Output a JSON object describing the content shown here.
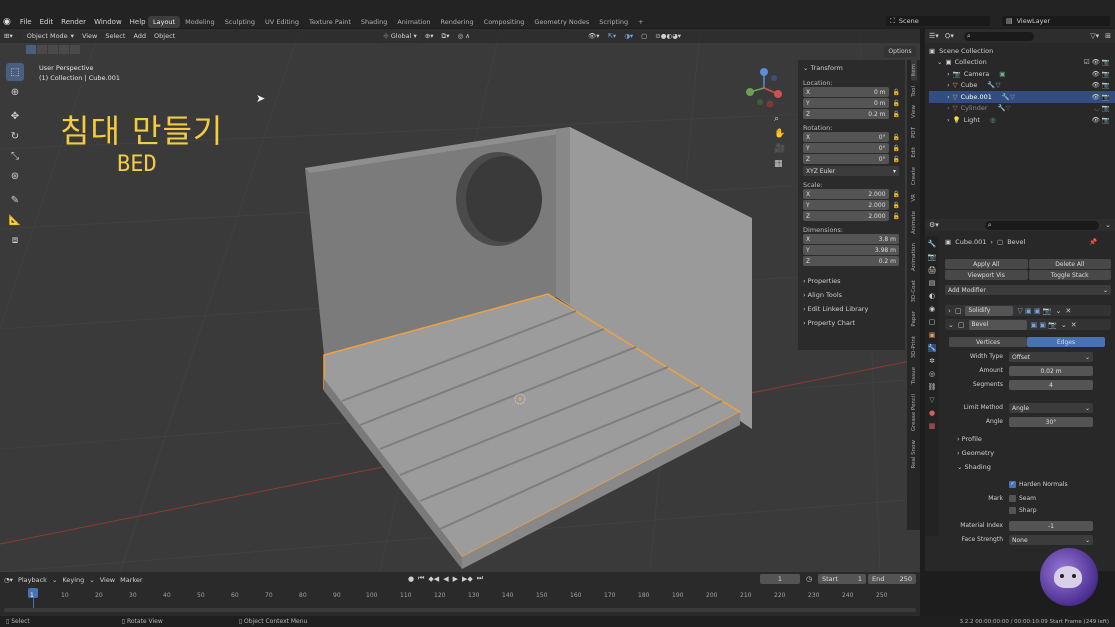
{
  "menu": {
    "items": [
      "File",
      "Edit",
      "Render",
      "Window",
      "Help"
    ],
    "workspaces": [
      "Layout",
      "Modeling",
      "Sculpting",
      "UV Editing",
      "Texture Paint",
      "Shading",
      "Animation",
      "Rendering",
      "Compositing",
      "Geometry Nodes",
      "Scripting"
    ],
    "active_workspace": "Layout",
    "add_tab": "+",
    "scene_label": "Scene",
    "viewlayer_label": "ViewLayer"
  },
  "viewport_header": {
    "mode": "Object Mode",
    "menus": [
      "View",
      "Select",
      "Add",
      "Object"
    ],
    "orientation": "Global",
    "options": "Options"
  },
  "viewport": {
    "perspective": "User Perspective",
    "collection_info": "(1) Collection | Cube.001",
    "title_korean": "침대 만들기",
    "title_english": "BED",
    "gizmo_axes": [
      "X",
      "Y",
      "Z"
    ]
  },
  "npanel": {
    "transform": "Transform",
    "location_label": "Location:",
    "location": [
      {
        "axis": "X",
        "value": "0 m"
      },
      {
        "axis": "Y",
        "value": "0 m"
      },
      {
        "axis": "Z",
        "value": "0.2 m"
      }
    ],
    "rotation_label": "Rotation:",
    "rotation": [
      {
        "axis": "X",
        "value": "0°"
      },
      {
        "axis": "Y",
        "value": "0°"
      },
      {
        "axis": "Z",
        "value": "0°"
      }
    ],
    "rotation_mode": "XYZ Euler",
    "scale_label": "Scale:",
    "scale": [
      {
        "axis": "X",
        "value": "2.000"
      },
      {
        "axis": "Y",
        "value": "2.000"
      },
      {
        "axis": "Z",
        "value": "2.000"
      }
    ],
    "dimensions_label": "Dimensions:",
    "dimensions": [
      {
        "axis": "X",
        "value": "3.8 m"
      },
      {
        "axis": "Y",
        "value": "3.98 m"
      },
      {
        "axis": "Z",
        "value": "0.2 m"
      }
    ],
    "sections": [
      "Properties",
      "Align Tools",
      "Edit Linked Library",
      "Property Chart"
    ]
  },
  "side_tabs": [
    "Item",
    "Tool",
    "View",
    "PDT",
    "Edit",
    "Create",
    "VR",
    "Animate",
    "Animation",
    "3D-Coat",
    "Paper",
    "3D-Print",
    "Tissue",
    "Grease Pencil",
    "Real Snow"
  ],
  "outliner": {
    "root": "Scene Collection",
    "collection": "Collection",
    "items": [
      {
        "name": "Camera",
        "selected": false,
        "color": "#e0a060"
      },
      {
        "name": "Cube",
        "selected": false,
        "color": "#e0a060"
      },
      {
        "name": "Cube.001",
        "selected": true,
        "color": "#e0a060"
      },
      {
        "name": "Cylinder",
        "selected": false,
        "color": "#e0a060"
      },
      {
        "name": "Light",
        "selected": false,
        "color": "#e0a060"
      }
    ]
  },
  "properties": {
    "object_name": "Cube.001",
    "modifier_name": "Bevel",
    "apply_all": "Apply All",
    "delete_all": "Delete All",
    "viewport_vis": "Viewport Vis",
    "toggle_stack": "Toggle Stack",
    "add_modifier": "Add Modifier",
    "modifiers": [
      "Solidify",
      "Bevel"
    ],
    "affect_options": [
      "Vertices",
      "Edges"
    ],
    "affect_active": "Edges",
    "width_type_label": "Width Type",
    "width_type": "Offset",
    "amount_label": "Amount",
    "amount": "0.02 m",
    "segments_label": "Segments",
    "segments": "4",
    "limit_method_label": "Limit Method",
    "limit_method": "Angle",
    "angle_label": "Angle",
    "angle": "30°",
    "subpanels": [
      "Profile",
      "Geometry",
      "Shading"
    ],
    "harden_normals": "Harden Normals",
    "mark_label": "Mark",
    "seam": "Seam",
    "sharp": "Sharp",
    "material_index_label": "Material Index",
    "material_index": "-1",
    "face_strength_label": "Face Strength",
    "face_strength": "None"
  },
  "timeline": {
    "menus": [
      "Playback",
      "Keying",
      "View",
      "Marker"
    ],
    "current_frame": "1",
    "start_label": "Start",
    "start": "1",
    "end_label": "End",
    "end": "250",
    "ticks": [
      "1",
      "10",
      "20",
      "30",
      "40",
      "50",
      "60",
      "70",
      "80",
      "90",
      "100",
      "110",
      "120",
      "130",
      "140",
      "150",
      "160",
      "170",
      "180",
      "190",
      "200",
      "210",
      "220",
      "230",
      "240",
      "250"
    ]
  },
  "status": {
    "select": "Select",
    "rotate": "Rotate View",
    "context": "Object Context Menu",
    "info": "3.2.2  00:00:00:00 / 00:00:10:09  Start Frame (249 left)"
  },
  "colors": {
    "accent": "#4772b3",
    "selection_outline": "#f0a040",
    "viewport_bg": "#3a3a3a"
  }
}
